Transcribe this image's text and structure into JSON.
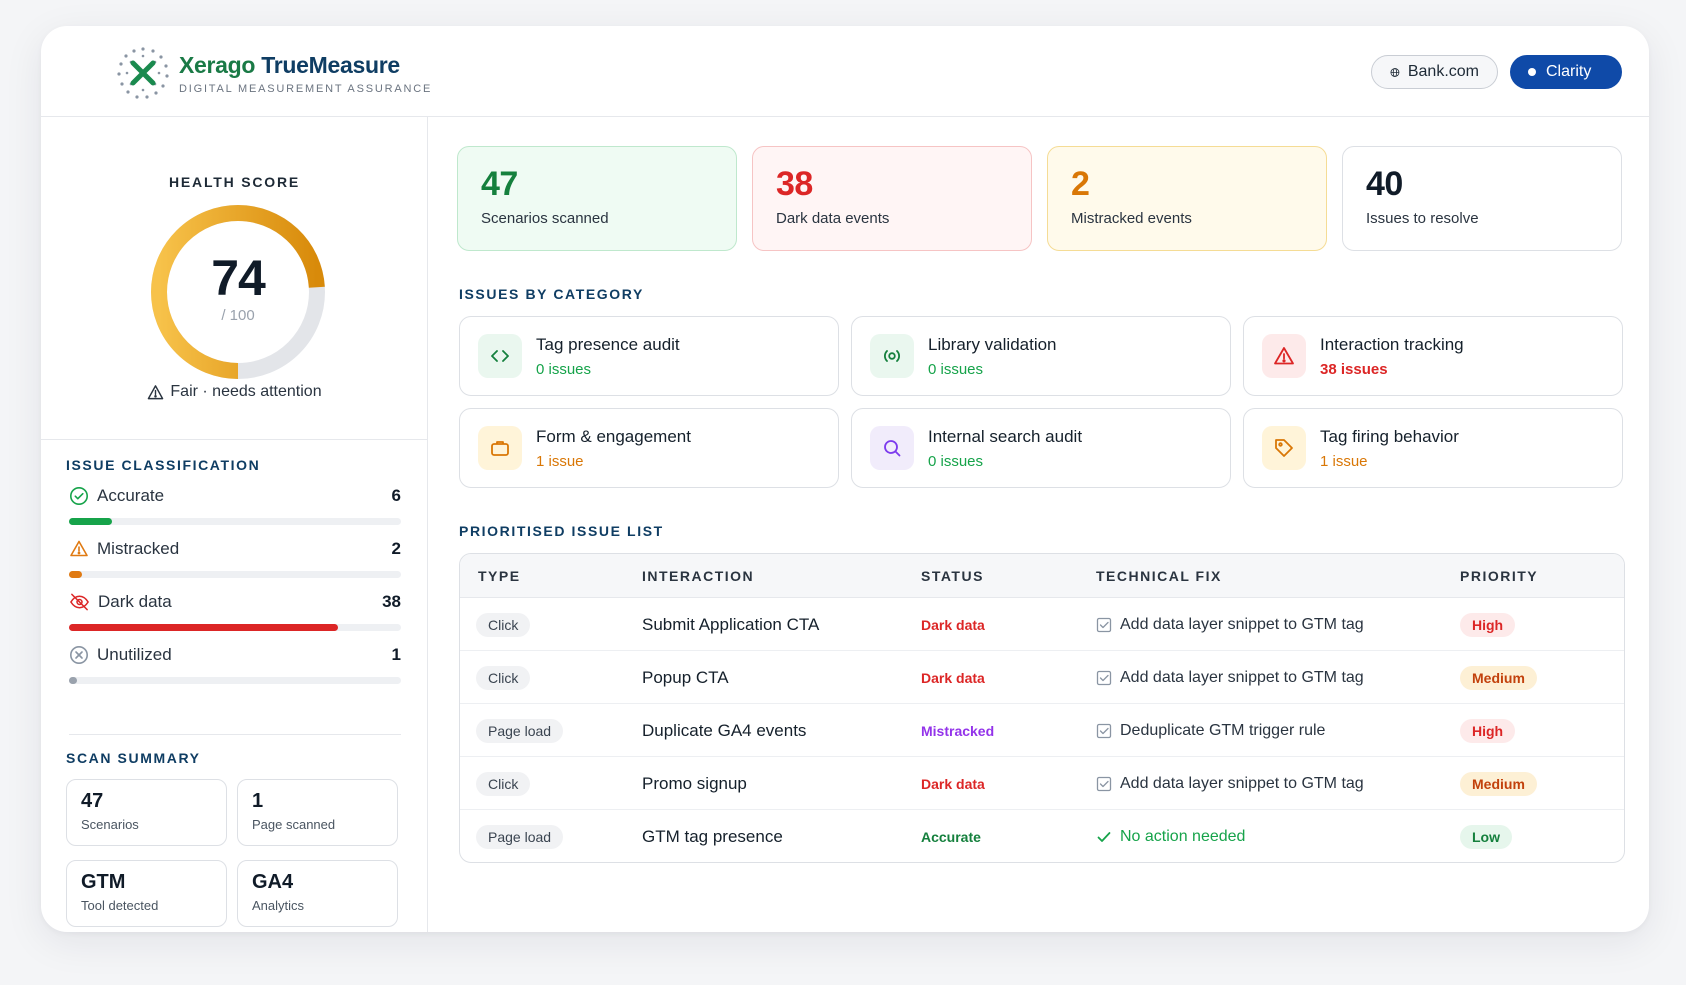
{
  "header": {
    "brand_primary": "Xerago",
    "brand_secondary": "TrueMeasure",
    "brand_subtitle": "DIGITAL MEASUREMENT ASSURANCE",
    "site_button": "Bank.com",
    "clarity_button": "Clarity"
  },
  "health": {
    "title": "HEALTH SCORE",
    "score": "74",
    "denominator": "/ 100",
    "score_fraction": 0.74,
    "status": "Fair · needs attention"
  },
  "classification": {
    "title": "ISSUE CLASSIFICATION",
    "items": [
      {
        "label": "Accurate",
        "count": "6",
        "fraction": 0.13,
        "color": "#16a34a"
      },
      {
        "label": "Mistracked",
        "count": "2",
        "fraction": 0.04,
        "color": "#e07a12"
      },
      {
        "label": "Dark data",
        "count": "38",
        "fraction": 0.81,
        "color": "#dc2626"
      },
      {
        "label": "Unutilized",
        "count": "1",
        "fraction": 0.02,
        "color": "#9aa2ad"
      }
    ]
  },
  "scan_summary": {
    "title": "SCAN SUMMARY",
    "items": [
      {
        "value": "47",
        "label": "Scenarios"
      },
      {
        "value": "1",
        "label": "Page scanned"
      },
      {
        "value": "GTM",
        "label": "Tool detected"
      },
      {
        "value": "GA4",
        "label": "Analytics"
      }
    ]
  },
  "stats": [
    {
      "value": "47",
      "label": "Scenarios scanned",
      "color": "#15803d",
      "bg": "#effbf3",
      "border": "#bfe8cd"
    },
    {
      "value": "38",
      "label": "Dark data events",
      "color": "#dc2626",
      "bg": "#fff5f5",
      "border": "#f6c4c4"
    },
    {
      "value": "2",
      "label": "Mistracked events",
      "color": "#d97706",
      "bg": "#fffaeb",
      "border": "#f5dc95"
    },
    {
      "value": "40",
      "label": "Issues to resolve",
      "color": "#101b28",
      "bg": "#ffffff",
      "border": "#dde0e5"
    }
  ],
  "categories": {
    "title": "ISSUES BY CATEGORY",
    "items": [
      {
        "name": "Tag presence audit",
        "count": "0 issues",
        "count_color": "#16a34a",
        "icon": "code-icon",
        "icon_bg": "#eaf7ef",
        "icon_color": "#15803d"
      },
      {
        "name": "Library validation",
        "count": "0 issues",
        "count_color": "#16a34a",
        "icon": "radio-icon",
        "icon_bg": "#eaf7ef",
        "icon_color": "#15803d"
      },
      {
        "name": "Interaction tracking",
        "count": "38 issues",
        "count_color": "#dc2626",
        "icon": "warning-icon",
        "icon_bg": "#fdeaea",
        "icon_color": "#dc2626"
      },
      {
        "name": "Form & engagement",
        "count": "1 issue",
        "count_color": "#d97706",
        "icon": "briefcase-icon",
        "icon_bg": "#fff4d9",
        "icon_color": "#d97706"
      },
      {
        "name": "Internal search audit",
        "count": "0 issues",
        "count_color": "#16a34a",
        "icon": "search-icon",
        "icon_bg": "#f1ecfb",
        "icon_color": "#7c3aed"
      },
      {
        "name": "Tag firing behavior",
        "count": "1 issue",
        "count_color": "#d97706",
        "icon": "tag-icon",
        "icon_bg": "#fff4d9",
        "icon_color": "#d97706"
      }
    ]
  },
  "issue_list": {
    "title": "PRIORITISED ISSUE LIST",
    "columns": [
      "TYPE",
      "INTERACTION",
      "STATUS",
      "TECHNICAL FIX",
      "PRIORITY"
    ],
    "rows": [
      {
        "type": "Click",
        "interaction": "Submit Application CTA",
        "status": "Dark data",
        "status_color": "#dc2626",
        "fix": "Add data layer snippet to GTM tag",
        "fix_kind": "checkbox",
        "priority": "High",
        "prio_bg": "#fdeaea",
        "prio_color": "#dc2626"
      },
      {
        "type": "Click",
        "interaction": "Popup CTA",
        "status": "Dark data",
        "status_color": "#dc2626",
        "fix": "Add data layer snippet to GTM tag",
        "fix_kind": "checkbox",
        "priority": "Medium",
        "prio_bg": "#fdf0d5",
        "prio_color": "#c2410c"
      },
      {
        "type": "Page load",
        "interaction": "Duplicate GA4 events",
        "status": "Mistracked",
        "status_color": "#9333ea",
        "fix": "Deduplicate GTM trigger rule",
        "fix_kind": "checkbox",
        "priority": "High",
        "prio_bg": "#fdeaea",
        "prio_color": "#dc2626"
      },
      {
        "type": "Click",
        "interaction": "Promo signup",
        "status": "Dark data",
        "status_color": "#dc2626",
        "fix": "Add data layer snippet to GTM tag",
        "fix_kind": "checkbox",
        "priority": "Medium",
        "prio_bg": "#fdf0d5",
        "prio_color": "#c2410c"
      },
      {
        "type": "Page load",
        "interaction": "GTM tag presence",
        "status": "Accurate",
        "status_color": "#15803d",
        "fix": "No action needed",
        "fix_kind": "check",
        "priority": "Low",
        "prio_bg": "#e6f6ec",
        "prio_color": "#15803d"
      }
    ]
  }
}
